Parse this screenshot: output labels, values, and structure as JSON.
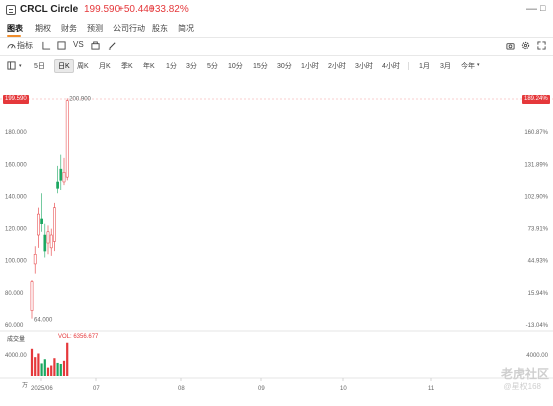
{
  "header": {
    "name": "CRCL Circle",
    "price": "199.590",
    "change": "+50.440",
    "change_pct": "+33.82%",
    "minimize": "—",
    "close": "□"
  },
  "tabs": [
    {
      "label": "图表",
      "active": true
    },
    {
      "label": "期权",
      "active": false
    },
    {
      "label": "财务",
      "active": false
    },
    {
      "label": "预测",
      "active": false
    },
    {
      "label": "公司行动",
      "active": false
    },
    {
      "label": "股东",
      "active": false
    },
    {
      "label": "简况",
      "active": false
    }
  ],
  "tools": {
    "indicator": "指标",
    "vs": "VS"
  },
  "periods": [
    "5日",
    "日K",
    "周K",
    "月K",
    "季K",
    "年K",
    "1分",
    "3分",
    "5分",
    "10分",
    "15分",
    "30分",
    "1小时",
    "2小时",
    "3小时",
    "4小时",
    "1月",
    "3月",
    "今年"
  ],
  "active_period": "日K",
  "chart_data": {
    "type": "candlestick",
    "y_left_ticks": [
      "180.000",
      "160.000",
      "140.000",
      "120.000",
      "100.000",
      "80.000",
      "60.000"
    ],
    "y_right_ticks": [
      "160.87%",
      "131.89%",
      "102.90%",
      "73.91%",
      "44.93%",
      "15.94%",
      "-13.04%"
    ],
    "x_ticks": [
      "2025/06",
      "07",
      "08",
      "09",
      "10",
      "11"
    ],
    "current_price_left": "199.590",
    "current_price_right": "189.24%",
    "high_label": "200.900",
    "low_label": "64.000",
    "ylim": [
      60,
      200
    ],
    "candles": [
      {
        "o": 69,
        "h": 88,
        "l": 64,
        "c": 87
      },
      {
        "o": 98,
        "h": 109,
        "l": 92,
        "c": 104
      },
      {
        "o": 116,
        "h": 133,
        "l": 108,
        "c": 129
      },
      {
        "o": 126,
        "h": 142,
        "l": 118,
        "c": 123
      },
      {
        "o": 116,
        "h": 123,
        "l": 102,
        "c": 106
      },
      {
        "o": 111,
        "h": 122,
        "l": 104,
        "c": 118
      },
      {
        "o": 108,
        "h": 120,
        "l": 103,
        "c": 116
      },
      {
        "o": 112,
        "h": 136,
        "l": 106,
        "c": 133
      },
      {
        "o": 149,
        "h": 159,
        "l": 142,
        "c": 145
      },
      {
        "o": 157,
        "h": 166,
        "l": 144,
        "c": 150
      },
      {
        "o": 149,
        "h": 164,
        "l": 147,
        "c": 155
      },
      {
        "o": 152,
        "h": 201,
        "l": 150,
        "c": 199.59
      }
    ],
    "volume": {
      "label": "成交量",
      "value_label": "VOL: 6356.677",
      "y_ticks": [
        "4000.00",
        "万"
      ],
      "y_right_tick": "4000.00",
      "values": [
        5200,
        3600,
        4300,
        2400,
        3200,
        1600,
        2000,
        3400,
        2500,
        2300,
        2900,
        6356.677
      ]
    }
  },
  "watermark": {
    "main": "老虎社区",
    "sub": "@星权168"
  }
}
